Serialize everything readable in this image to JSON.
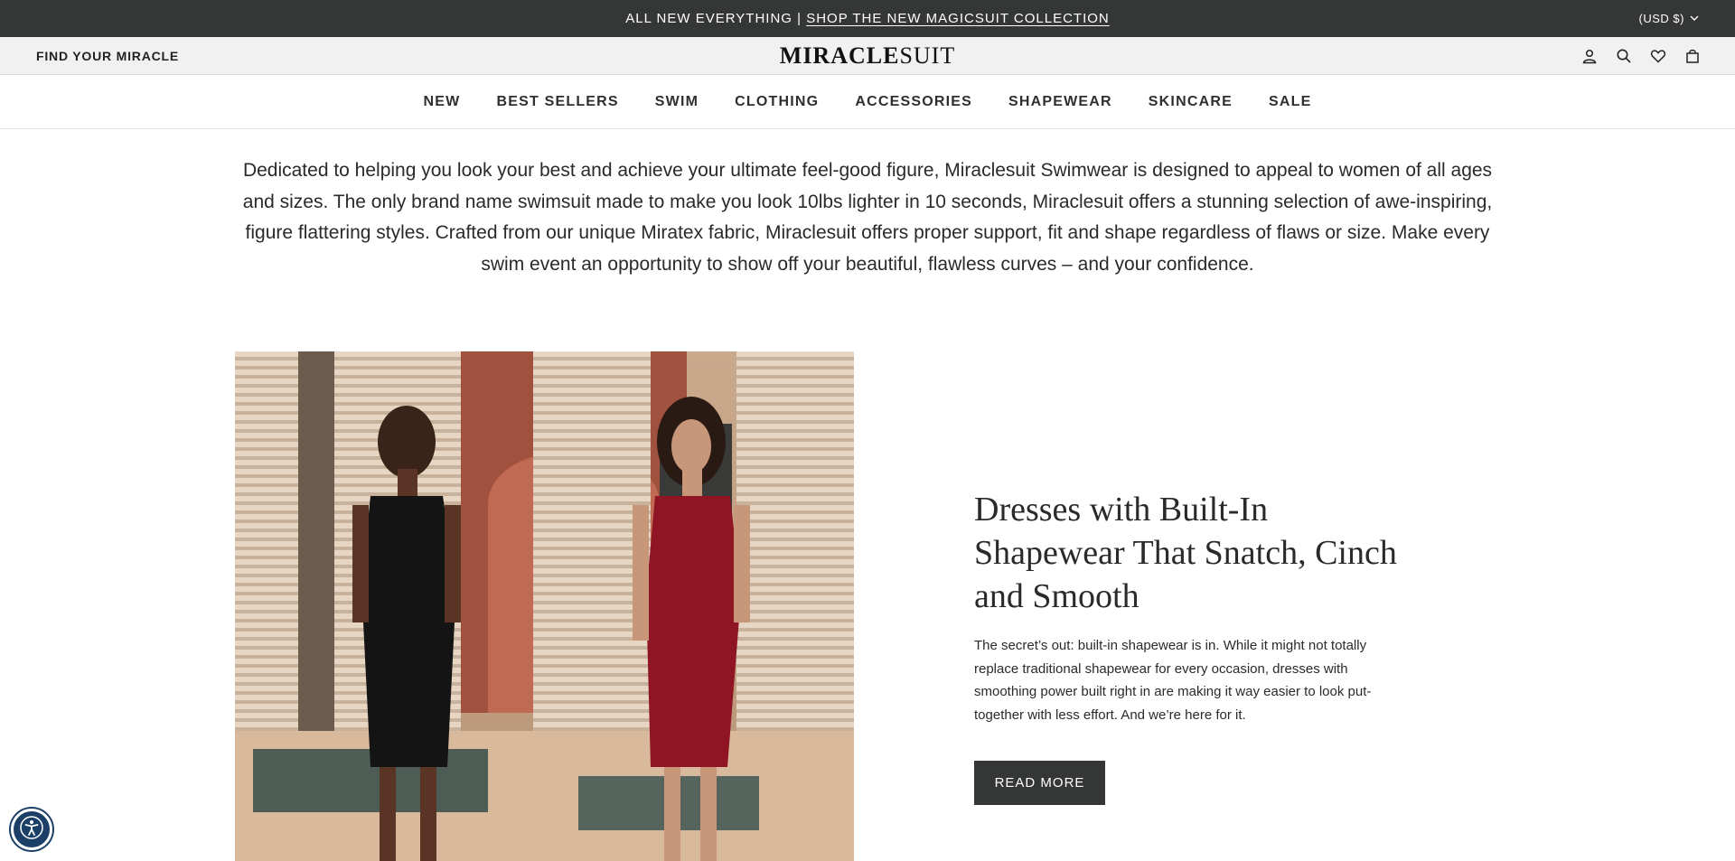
{
  "announcement": {
    "prefix": "ALL NEW EVERYTHING | ",
    "link": "SHOP THE NEW MAGICSUIT COLLECTION"
  },
  "currency": {
    "label": "(USD $)",
    "icon": "chevron-down-icon"
  },
  "header": {
    "find_label": "FIND YOUR MIRACLE",
    "logo_bold": "MIRACLE",
    "logo_light": "SUIT",
    "icons": [
      "account-icon",
      "search-icon",
      "wishlist-heart-icon",
      "cart-bag-icon"
    ]
  },
  "nav": {
    "items": [
      "NEW",
      "BEST SELLERS",
      "SWIM",
      "CLOTHING",
      "ACCESSORIES",
      "SHAPEWEAR",
      "SKINCARE",
      "SALE"
    ]
  },
  "intro": {
    "text": "Dedicated to helping you look your best and achieve your ultimate feel-good figure, Miraclesuit Swimwear is designed to appeal to women of all ages and sizes. The only brand name swimsuit made to make you look 10lbs lighter in 10 seconds, Miraclesuit offers a stunning selection of awe-inspiring, figure flattering styles. Crafted from our unique Miratex fabric, Miraclesuit offers proper support, fit and shape regardless of flaws or size. Make every swim event an opportunity to show off your beautiful, flawless curves – and your confidence."
  },
  "feature": {
    "heading": "Dresses with Built-In Shapewear That Snatch, Cinch and Smooth",
    "body": "The secret’s out: built-in shapewear is in. While it might not totally replace traditional shapewear for every occasion, dresses with smoothing power built right in are making it way easier to look put-together with less effort. And we’re here for it.",
    "button": "READ MORE",
    "image": "two-women-in-black-and-red-dresses-photo"
  },
  "accessibility": {
    "icon": "accessibility-person-icon"
  },
  "colors": {
    "announce_bg": "#343735",
    "header_bg": "#f1f1f1",
    "button_bg": "#343735",
    "a11y_bg": "#1b3f66"
  }
}
